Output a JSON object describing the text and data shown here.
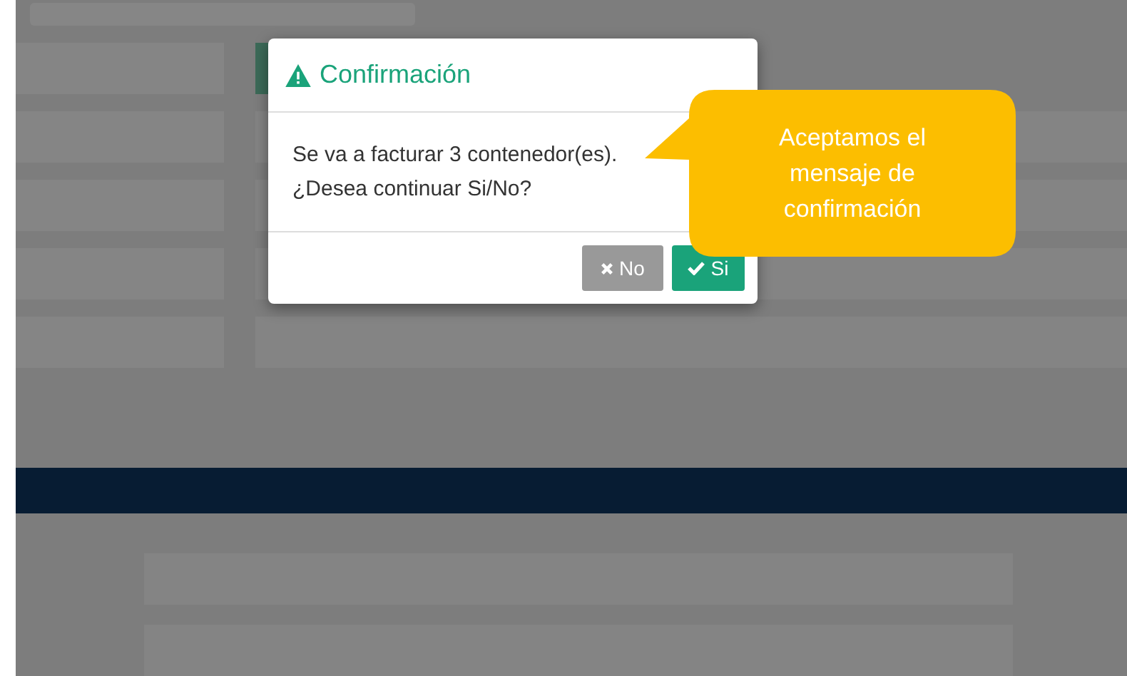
{
  "dialog": {
    "title": "Confirmación",
    "message_lines": [
      "Se va a facturar 3 contenedor(es).",
      "¿Desea continuar Si/No?"
    ],
    "buttons": [
      {
        "kind": "cancel",
        "label": "No"
      },
      {
        "kind": "confirm",
        "label": "Si"
      }
    ]
  },
  "callout": {
    "text": "Aceptamos el mensaje de confirmación"
  }
}
